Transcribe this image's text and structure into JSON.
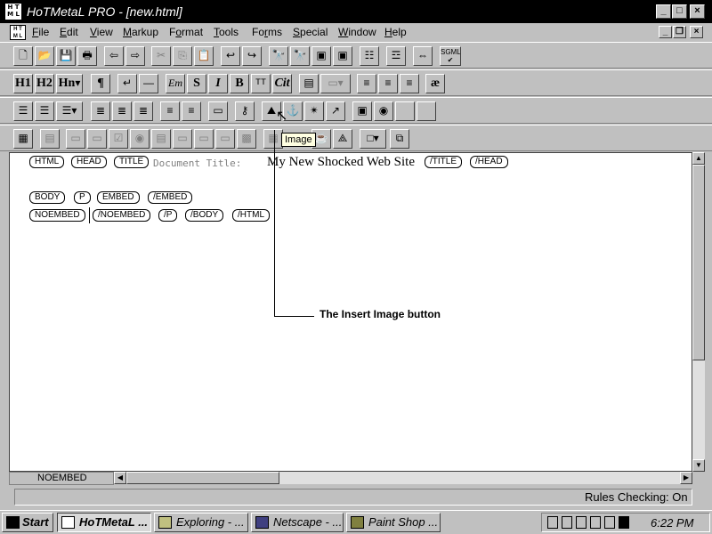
{
  "window": {
    "app_icon": "HoTMetaL logo",
    "title": "HoTMetaL PRO - [new.html]",
    "controls": {
      "minimize": "_",
      "maximize": "□",
      "close": "×"
    }
  },
  "menubar": {
    "items": [
      "File",
      "Edit",
      "View",
      "Markup",
      "Format",
      "Tools",
      "Forms",
      "Special",
      "Window",
      "Help"
    ],
    "underline": [
      "F",
      "E",
      "V",
      "M",
      "o",
      "T",
      "r",
      "S",
      "W",
      "H"
    ]
  },
  "toolbar_row2": {
    "labels": [
      "H1",
      "H2",
      "Hn",
      "¶",
      "S",
      "I",
      "B",
      "TT",
      "Cit",
      "æ"
    ],
    "em": "Em"
  },
  "tooltip": "Image",
  "sgml": "SGML",
  "editor": {
    "line1": {
      "html_open": "HTML",
      "head_open": "HEAD",
      "title_open": "TITLE",
      "doc_title_label": "Document Title:",
      "doc_title": "My New Shocked Web Site",
      "title_close": "/TITLE",
      "head_close": "/HEAD"
    },
    "line2": {
      "body": "BODY",
      "p": "P",
      "embed": "EMBED",
      "embed_close": "/EMBED"
    },
    "line3": {
      "noembed": "NOEMBED",
      "noembed_close": "/NOEMBED",
      "p_close": "/P",
      "body_close": "/BODY",
      "html_close": "/HTML"
    }
  },
  "annotation": "The Insert Image button",
  "status": {
    "element": "NOEMBED",
    "rules": "Rules Checking: On"
  },
  "taskbar": {
    "start": "Start",
    "tasks": [
      "HoTMetaL ...",
      "Exploring - ...",
      "Netscape - ...",
      "Paint Shop ..."
    ],
    "clock": "6:22 PM"
  }
}
